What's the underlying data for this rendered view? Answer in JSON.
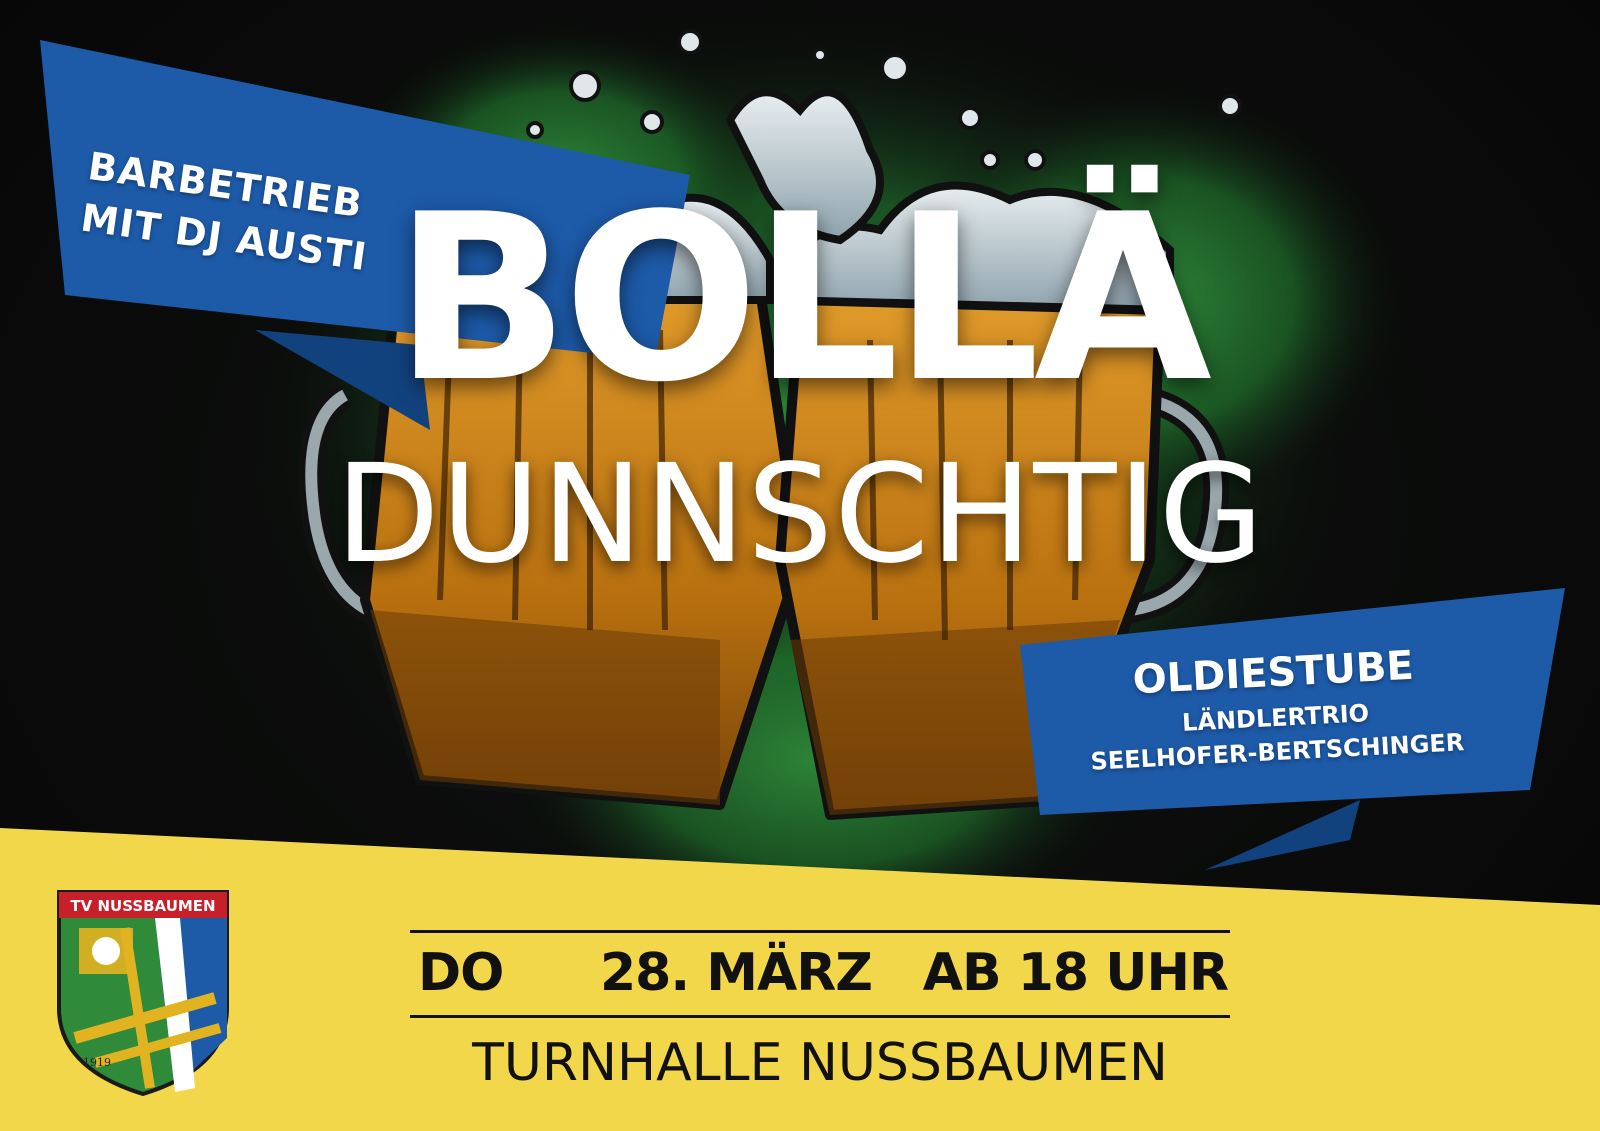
{
  "banner_left": {
    "line1": "BARBETRIEB",
    "line2": "MIT DJ AUSTI"
  },
  "title": {
    "line1": "BOLLÄ",
    "line2": "DUNNSCHTIG"
  },
  "banner_right": {
    "heading": "OLDIESTUBE",
    "line1": "LÄNDLERTRIO",
    "line2": "SEELHOFER-BERTSCHINGER"
  },
  "logo": {
    "title": "TV NUSSBAUMEN",
    "year": "1919"
  },
  "event": {
    "day": "DO",
    "date": "28. MÄRZ",
    "time": "AB 18 UHR",
    "venue": "TURNHALLE NUSSBAUMEN"
  },
  "colors": {
    "background": "#0b0b0b",
    "smoke_green": "#2f8a3a",
    "banner_blue": "#1d5aa8",
    "banner_blue_dark": "#12427e",
    "footer_yellow": "#f3d74a",
    "beer_amber": "#c47a14",
    "text_dark": "#111111"
  },
  "icons": [
    "beer-mug-icon",
    "beer-mug-icon",
    "foam-bubble-icon",
    "club-crest-icon"
  ]
}
